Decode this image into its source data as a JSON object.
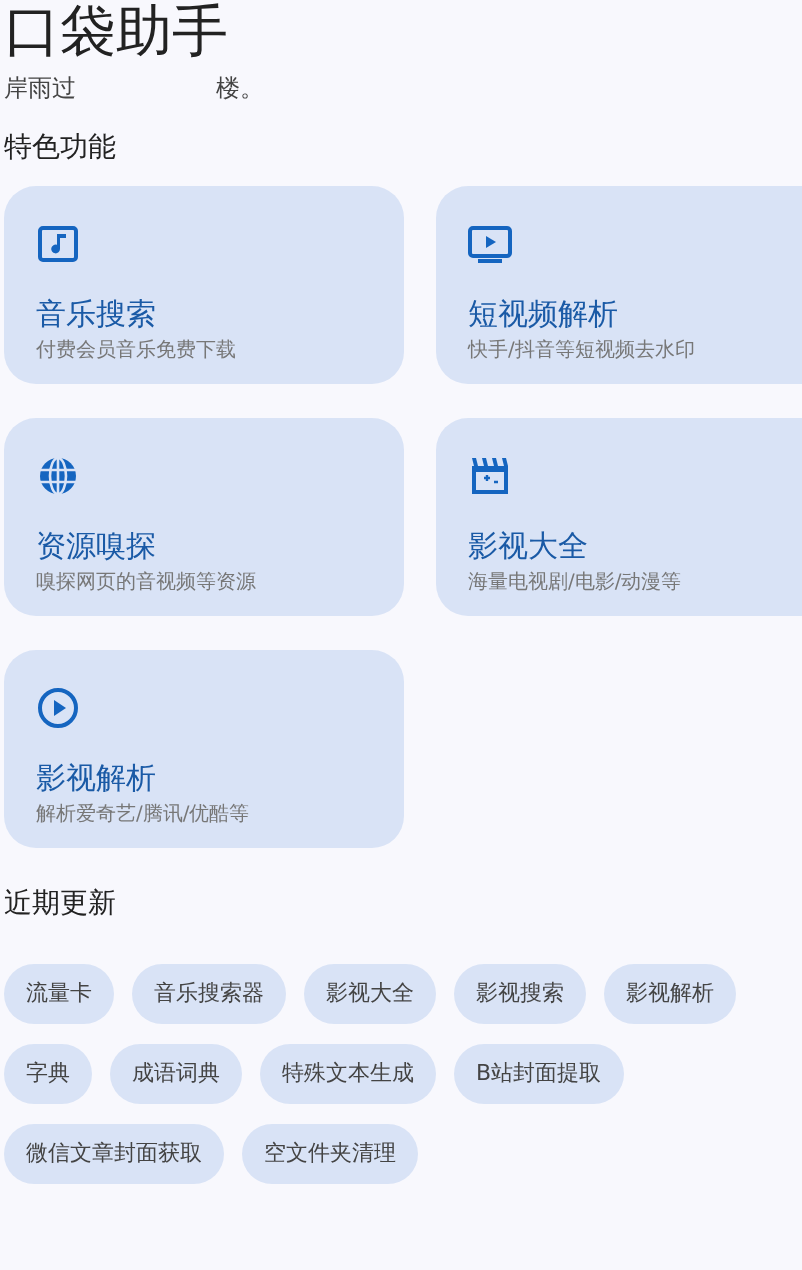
{
  "app_title": "口袋助手",
  "subtitle_parts": [
    "岸雨过",
    "楼。"
  ],
  "features": {
    "heading": "特色功能",
    "cards": [
      {
        "title": "音乐搜索",
        "description": "付费会员音乐免费下载"
      },
      {
        "title": "短视频解析",
        "description": "快手/抖音等短视频去水印"
      },
      {
        "title": "资源嗅探",
        "description": "嗅探网页的音视频等资源"
      },
      {
        "title": "影视大全",
        "description": "海量电视剧/电影/动漫等"
      },
      {
        "title": "影视解析",
        "description": "解析爱奇艺/腾讯/优酷等"
      }
    ]
  },
  "recent": {
    "heading": "近期更新",
    "chips": [
      "流量卡",
      "音乐搜索器",
      "影视大全",
      "影视搜索",
      "影视解析",
      "字典",
      "成语词典",
      "特殊文本生成",
      "B站封面提取",
      "微信文章封面获取",
      "空文件夹清理"
    ]
  }
}
